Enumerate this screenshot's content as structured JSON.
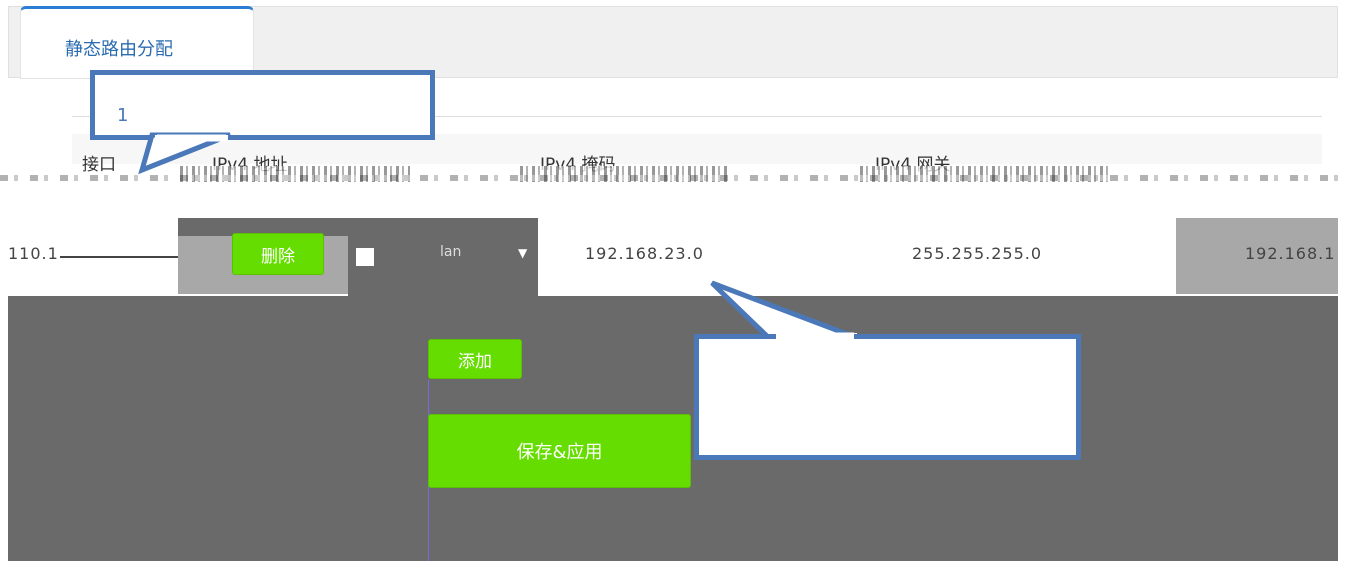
{
  "tabs": [
    {
      "label": "静态路由分配"
    }
  ],
  "callouts": [
    {
      "label": "1"
    },
    {
      "label": ""
    }
  ],
  "table": {
    "headers": [
      "接口",
      "IPv4 地址",
      "IPv4 掩码",
      "IPv4 网关"
    ],
    "row": {
      "interface_value": "110.1",
      "delete_label": "删除",
      "select_value": "lan",
      "ipv4_address": "192.168.23.0",
      "ipv4_mask": "255.255.255.0",
      "ipv4_gateway": "192.168.1"
    }
  },
  "actions": {
    "add_label": "添加",
    "save_label": "保存&应用"
  },
  "colors": {
    "accent": "#2b7cd3",
    "button": "#66dd00",
    "callout_border": "#4a78b8",
    "dark_area": "#6a6a6a"
  }
}
